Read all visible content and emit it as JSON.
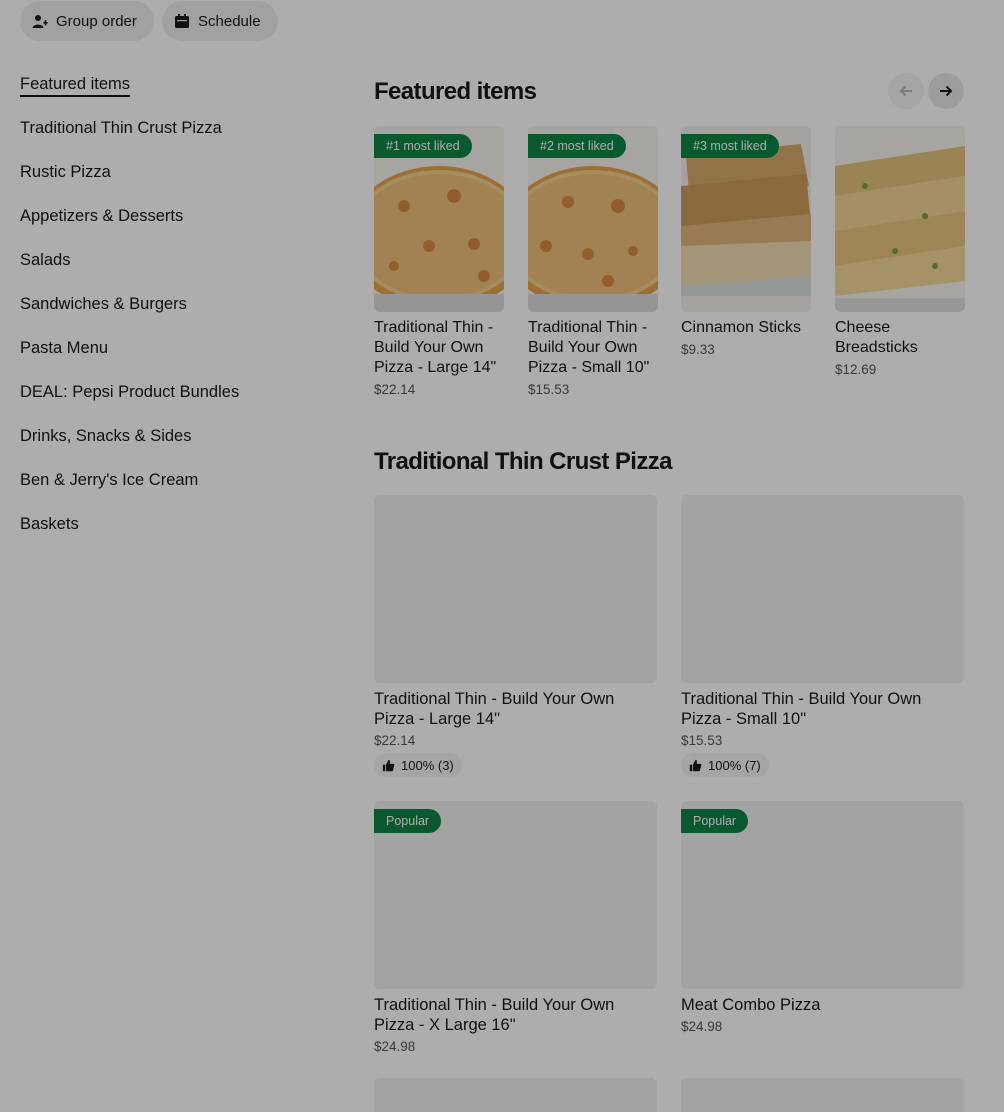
{
  "top_actions": {
    "group_order": "Group order",
    "schedule": "Schedule"
  },
  "menu": {
    "items": [
      "Featured items",
      "Traditional Thin Crust Pizza",
      "Rustic Pizza",
      "Appetizers & Desserts",
      "Salads",
      "Sandwiches & Burgers",
      "Pasta Menu",
      "DEAL: Pepsi Product Bundles",
      "Drinks, Snacks & Sides",
      "Ben & Jerry's Ice Cream",
      "Baskets"
    ]
  },
  "featured": {
    "title": "Featured items",
    "items": [
      {
        "badge": "#1 most liked",
        "name": "Traditional Thin - Build Your Own Pizza - Large 14\"",
        "price": "$22.14"
      },
      {
        "badge": "#2 most liked",
        "name": "Traditional Thin - Build Your Own Pizza - Small 10\"",
        "price": "$15.53"
      },
      {
        "badge": "#3 most liked",
        "name": "Cinnamon Sticks",
        "price": "$9.33"
      },
      {
        "badge": "",
        "name": "Cheese Breadsticks",
        "price": "$12.69"
      }
    ]
  },
  "traditional": {
    "title": "Traditional Thin Crust Pizza",
    "items": [
      {
        "name": "Traditional Thin - Build Your Own Pizza - Large 14\"",
        "price": "$22.14",
        "rating": "100% (3)",
        "badge": ""
      },
      {
        "name": "Traditional Thin - Build Your Own Pizza - Small 10\"",
        "price": "$15.53",
        "rating": "100% (7)",
        "badge": ""
      },
      {
        "name": "Traditional Thin - Build Your Own Pizza - X Large 16\"",
        "price": "$24.98",
        "rating": "",
        "badge": "Popular"
      },
      {
        "name": "Meat Combo Pizza",
        "price": "$24.98",
        "rating": "",
        "badge": "Popular"
      }
    ]
  },
  "colors": {
    "badge_green": "#0e8345",
    "overlay": "rgba(0,0,0,0.32)"
  }
}
